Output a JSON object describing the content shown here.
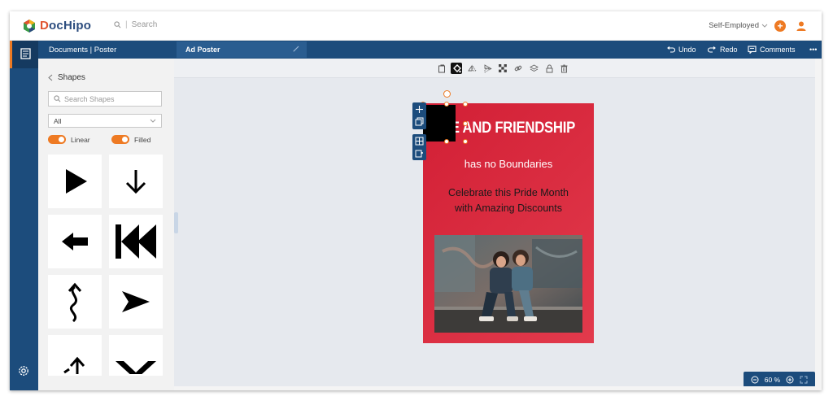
{
  "app": {
    "name_first": "D",
    "name_rest": "ocHipo"
  },
  "search": {
    "placeholder": "Search"
  },
  "account": {
    "label": "Self-Employed"
  },
  "header": {
    "breadcrumb": "Documents | Poster",
    "document_name": "Ad Poster",
    "undo_label": "Undo",
    "redo_label": "Redo",
    "comments_label": "Comments",
    "more_label": "•••"
  },
  "panel": {
    "title": "Shapes",
    "search_placeholder": "Search Shapes",
    "filter_value": "All",
    "toggle_linear": "Linear",
    "toggle_filled": "Filled",
    "shapes": [
      "play-arrow-icon",
      "arrow-down-icon",
      "arrow-left-icon",
      "rewind-icon",
      "wavy-arrow-up-icon",
      "navigation-arrow-icon",
      "arrow-up-partial-icon",
      "chevron-down-partial-icon"
    ]
  },
  "poster": {
    "headline": "VE AND FRIENDSHIP",
    "subheading": "has no Boundaries",
    "body_line1": "Celebrate this Pride Month",
    "body_line2": "with Amazing Discounts"
  },
  "zoom": {
    "level": "60 %"
  },
  "colors": {
    "navy": "#1c4c7c",
    "accent_orange": "#ee7a23",
    "poster_red": "#d21f35"
  }
}
